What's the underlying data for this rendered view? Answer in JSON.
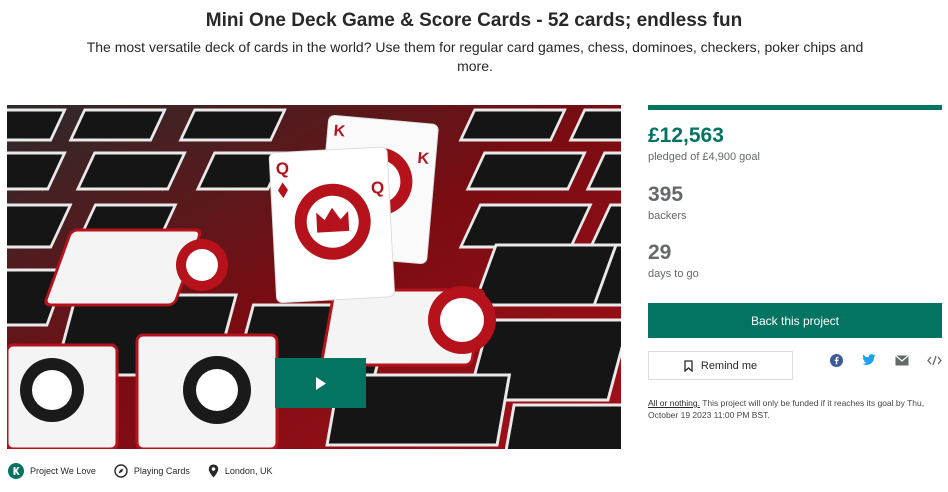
{
  "project": {
    "title": "Mini One Deck Game & Score Cards - 52 cards; endless fun",
    "blurb": "The most versatile deck of cards in the world? Use them for regular card games, chess, dominoes, checkers, poker chips and more."
  },
  "stats": {
    "pledged_amount": "£12,563",
    "pledged_label": "pledged of £4,900 goal",
    "backers_count": "395",
    "backers_label": "backers",
    "days_count": "29",
    "days_label": "days to go"
  },
  "actions": {
    "back_label": "Back this project",
    "remind_label": "Remind me"
  },
  "share_icons": [
    "facebook-icon",
    "twitter-icon",
    "email-icon",
    "embed-icon"
  ],
  "funding_note": {
    "link_text": "All or nothing.",
    "text": " This project will only be funded if it reaches its goal by Thu, October 19 2023 11:00 PM BST."
  },
  "tags": [
    {
      "label": "Project We Love",
      "icon": "kickstarter-badge-icon"
    },
    {
      "label": "Playing Cards",
      "icon": "compass-icon"
    },
    {
      "label": "London, UK",
      "icon": "location-pin-icon"
    }
  ],
  "colors": {
    "brand_green": "#037362",
    "card_red": "#b5121b",
    "text_dark": "#282828",
    "text_gray": "#656969"
  }
}
